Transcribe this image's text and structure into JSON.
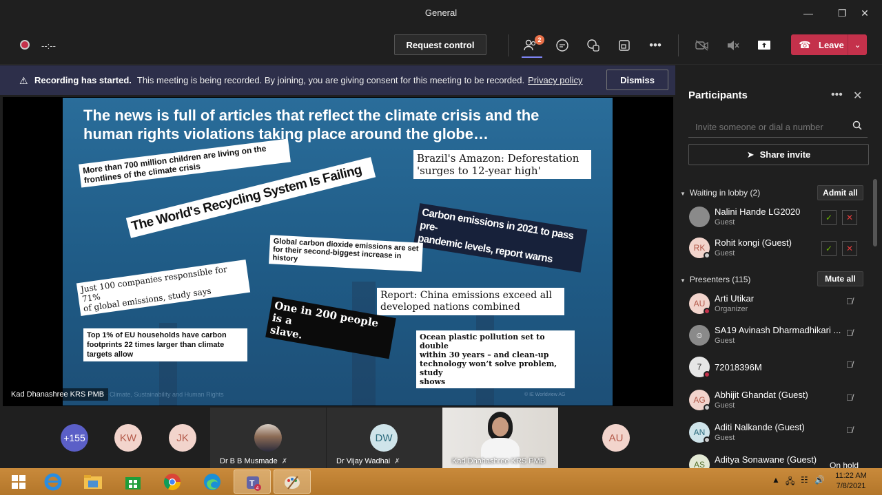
{
  "window": {
    "title": "General"
  },
  "toolbar": {
    "timer": "--:--",
    "request_control": "Request control",
    "participants_badge": "2",
    "leave_label": "Leave"
  },
  "banner": {
    "bold": "Recording has started.",
    "message": "This meeting is being recorded. By joining, you are giving consent for this meeting to be recorded.",
    "link": "Privacy policy",
    "dismiss": "Dismiss"
  },
  "slide": {
    "title_line1": "The news is full of articles that reflect the climate crisis and the",
    "title_line2": "human rights violations taking place around the globe…",
    "clips": {
      "children_1": "More than 700 million children are living on the",
      "children_2": "frontlines of the climate crisis",
      "recycling": "The World's Recycling System Is Failing",
      "amazon_1": "Brazil's Amazon: Deforestation",
      "amazon_2": "'surges to 12-year high'",
      "carbon_1": "Carbon emissions in 2021 to pass pre-",
      "carbon_2": "pandemic levels, report warns",
      "co2_1": "Global carbon dioxide emissions are set",
      "co2_2": "for their second-biggest increase in",
      "co2_3": "history",
      "companies_1": "Just 100 companies responsible for 71%",
      "companies_2": "of global emissions, study says",
      "china_1": "Report: China emissions exceed all",
      "china_2": "developed nations combined",
      "slave_1": "One in 200 people is a",
      "slave_2": "slave.",
      "eu_1": "Top 1% of EU households have carbon",
      "eu_2": "footprints 22 times larger than climate",
      "eu_3": "targets allow",
      "ocean_1": "Ocean plastic pollution set to double",
      "ocean_2": "within 30 years – and clean-up",
      "ocean_3": "technology won’t solve problem, study",
      "ocean_4": "shows"
    },
    "footer": "2021 · Climate, Sustainability and Human Rights",
    "credit": "© IE Worldview AG"
  },
  "speaker": {
    "name": "Kad Dhanashree KRS PMB"
  },
  "gallery": {
    "overflow": "+155",
    "kw": "KW",
    "jk": "JK",
    "dw": "DW",
    "au": "AU",
    "musmade": "Dr B B Musmade",
    "wadhai": "Dr Vijay Wadhai",
    "kad": "Kad Dhahashree KRS PMB"
  },
  "panel": {
    "title": "Participants",
    "invite_placeholder": "Invite someone or dial a number",
    "share_invite": "Share invite",
    "lobby_header": "Waiting in lobby (2)",
    "admit_all": "Admit all",
    "presenters_header": "Presenters (115)",
    "mute_all": "Mute all",
    "lobby": [
      {
        "name": "Nalini Hande LG2020",
        "role": "Guest",
        "initials": ""
      },
      {
        "name": "Rohit kongi (Guest)",
        "role": "Guest",
        "initials": "RK"
      }
    ],
    "presenters": [
      {
        "name": "Arti Utikar",
        "role": "Organizer",
        "initials": "AU"
      },
      {
        "name": "SA19 Avinash Dharmadhikari ...",
        "role": "Guest",
        "initials": ""
      },
      {
        "name": "72018396M",
        "role": "",
        "initials": "7"
      },
      {
        "name": "Abhijit Ghandat (Guest)",
        "role": "Guest",
        "initials": "AG"
      },
      {
        "name": "Aditi Nalkande (Guest)",
        "role": "Guest",
        "initials": "AN"
      },
      {
        "name": "Aditya Sonawane (Guest)",
        "role": "",
        "initials": "AS"
      }
    ],
    "on_hold": "On hold"
  },
  "taskbar": {
    "time": "11:22 AM",
    "date": "7/8/2021"
  }
}
